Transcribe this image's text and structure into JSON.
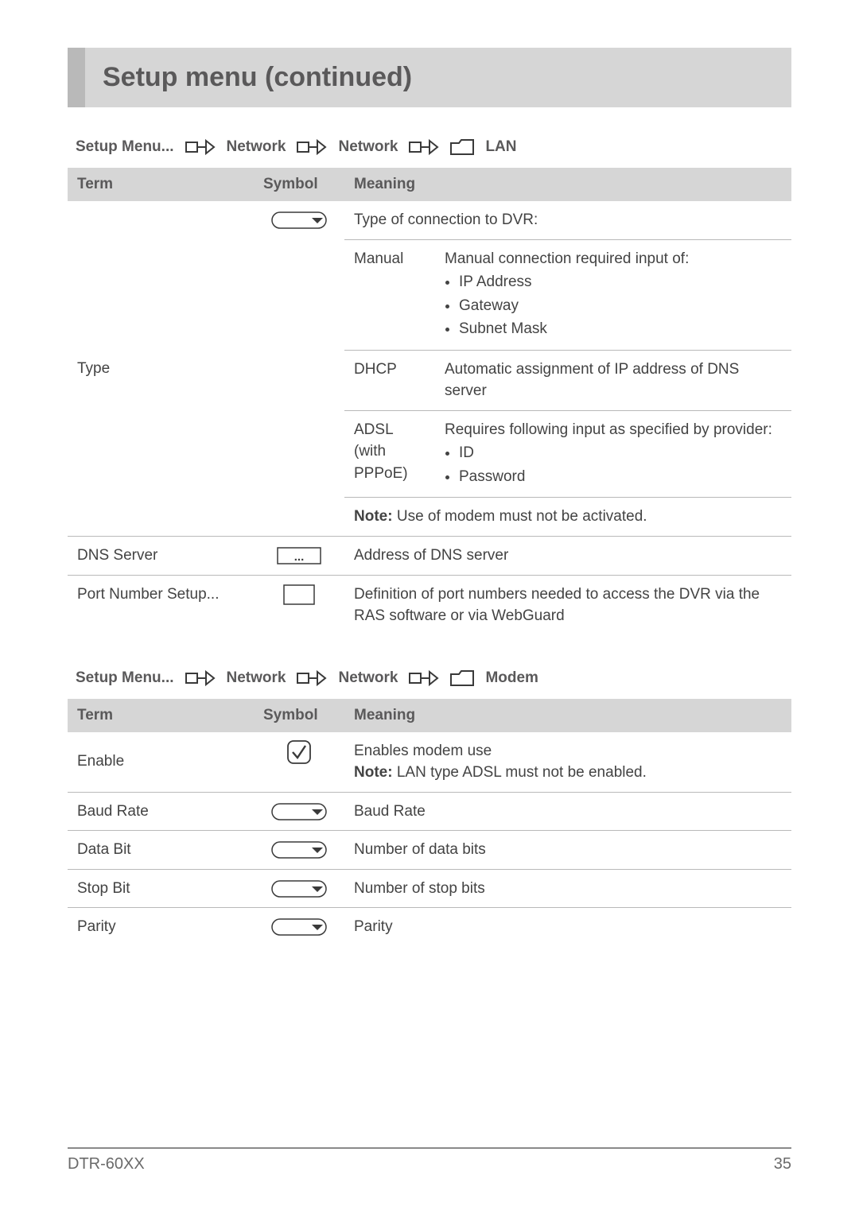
{
  "title": "Setup menu (continued)",
  "footer": {
    "model": "DTR-60XX",
    "page": "35"
  },
  "sections": [
    {
      "breadcrumb": [
        "Setup Menu...",
        "Network",
        "Network",
        "LAN"
      ],
      "headers": [
        "Term",
        "Symbol",
        "Meaning"
      ],
      "rows": {
        "type": {
          "term": "Type",
          "intro": "Type of connection to DVR:",
          "options": [
            {
              "name": "Manual",
              "desc_lead": "Manual connection required input of:",
              "bullets": [
                "IP Address",
                "Gateway",
                "Subnet Mask"
              ]
            },
            {
              "name": "DHCP",
              "desc": "Automatic assignment of IP address of DNS server"
            },
            {
              "name": "ADSL (with PPPoE)",
              "desc_lead": "Requires following input as specified by provider:",
              "bullets": [
                "ID",
                "Password"
              ]
            }
          ],
          "note_label": "Note:",
          "note_text": " Use of modem must not be activated."
        },
        "dns": {
          "term": "DNS Server",
          "meaning": "Address of DNS server"
        },
        "port": {
          "term": "Port Number Setup...",
          "meaning": "Definition of port numbers needed to access the DVR via the RAS software or via WebGuard"
        }
      }
    },
    {
      "breadcrumb": [
        "Setup Menu...",
        "Network",
        "Network",
        "Modem"
      ],
      "headers": [
        "Term",
        "Symbol",
        "Meaning"
      ],
      "rows": {
        "enable": {
          "term": "Enable",
          "meaning": "Enables modem use",
          "note_label": "Note:",
          "note_text": " LAN type ADSL must not be enabled."
        },
        "baud": {
          "term": "Baud Rate",
          "meaning": "Baud Rate"
        },
        "databit": {
          "term": "Data Bit",
          "meaning": "Number of data bits"
        },
        "stopbit": {
          "term": "Stop Bit",
          "meaning": "Number of stop bits"
        },
        "parity": {
          "term": "Parity",
          "meaning": "Parity"
        }
      }
    }
  ]
}
